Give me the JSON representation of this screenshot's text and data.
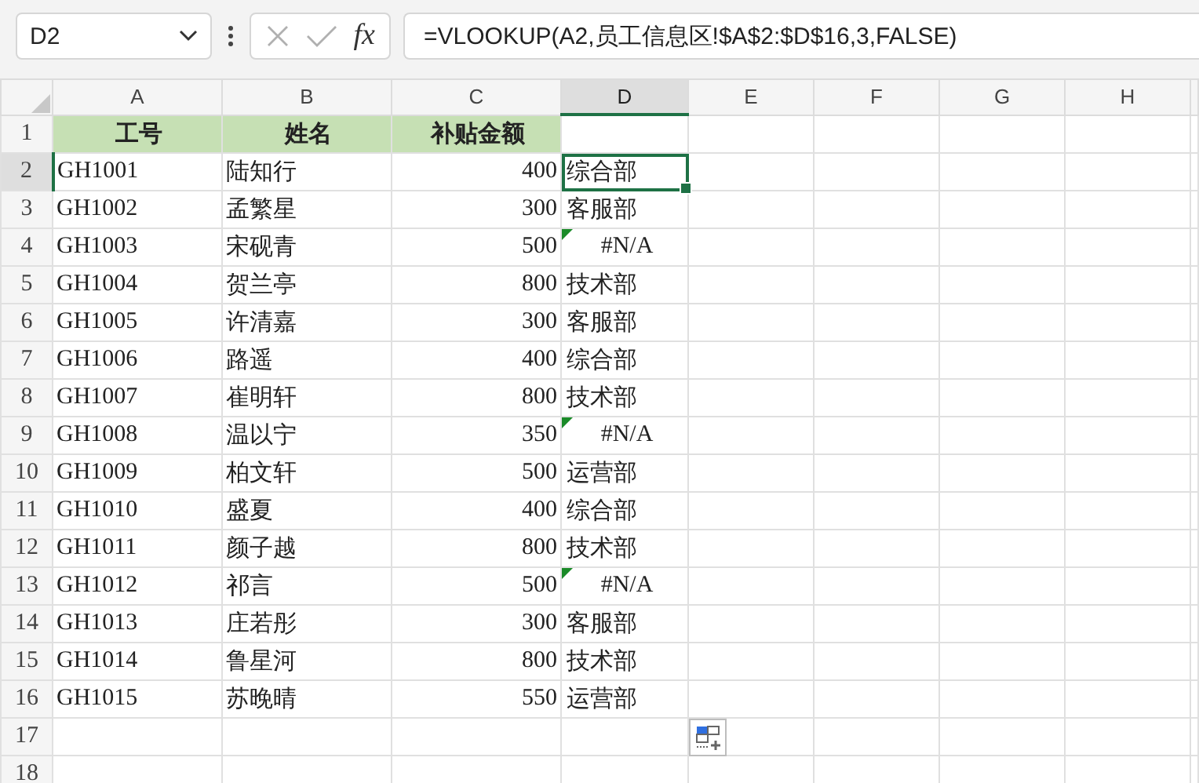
{
  "name_box": "D2",
  "formula_bar": {
    "function_label": "fx",
    "formula": "=VLOOKUP(A2,员工信息区!$A$2:$D$16,3,FALSE)"
  },
  "columns": [
    {
      "label": "A",
      "selected": false
    },
    {
      "label": "B",
      "selected": false
    },
    {
      "label": "C",
      "selected": false
    },
    {
      "label": "D",
      "selected": true
    },
    {
      "label": "E",
      "selected": false
    },
    {
      "label": "F",
      "selected": false
    },
    {
      "label": "G",
      "selected": false
    },
    {
      "label": "H",
      "selected": false
    }
  ],
  "rows": [
    {
      "kind": "header",
      "number": "1",
      "selected": false,
      "cells": [
        "工号",
        "姓名",
        "补贴金额"
      ]
    },
    {
      "kind": "data",
      "number": "2",
      "selected": true,
      "id": "GH1001",
      "name": "陆知行",
      "amount": "400",
      "dept": "综合部",
      "dept_error": false
    },
    {
      "kind": "data",
      "number": "3",
      "selected": false,
      "id": "GH1002",
      "name": "孟繁星",
      "amount": "300",
      "dept": "客服部",
      "dept_error": false
    },
    {
      "kind": "data",
      "number": "4",
      "selected": false,
      "id": "GH1003",
      "name": "宋砚青",
      "amount": "500",
      "dept": "#N/A",
      "dept_error": true
    },
    {
      "kind": "data",
      "number": "5",
      "selected": false,
      "id": "GH1004",
      "name": "贺兰亭",
      "amount": "800",
      "dept": "技术部",
      "dept_error": false
    },
    {
      "kind": "data",
      "number": "6",
      "selected": false,
      "id": "GH1005",
      "name": "许清嘉",
      "amount": "300",
      "dept": "客服部",
      "dept_error": false
    },
    {
      "kind": "data",
      "number": "7",
      "selected": false,
      "id": "GH1006",
      "name": "路遥",
      "amount": "400",
      "dept": "综合部",
      "dept_error": false
    },
    {
      "kind": "data",
      "number": "8",
      "selected": false,
      "id": "GH1007",
      "name": "崔明轩",
      "amount": "800",
      "dept": "技术部",
      "dept_error": false
    },
    {
      "kind": "data",
      "number": "9",
      "selected": false,
      "id": "GH1008",
      "name": "温以宁",
      "amount": "350",
      "dept": "#N/A",
      "dept_error": true
    },
    {
      "kind": "data",
      "number": "10",
      "selected": false,
      "id": "GH1009",
      "name": "柏文轩",
      "amount": "500",
      "dept": "运营部",
      "dept_error": false
    },
    {
      "kind": "data",
      "number": "11",
      "selected": false,
      "id": "GH1010",
      "name": "盛夏",
      "amount": "400",
      "dept": "综合部",
      "dept_error": false
    },
    {
      "kind": "data",
      "number": "12",
      "selected": false,
      "id": "GH1011",
      "name": "颜子越",
      "amount": "800",
      "dept": "技术部",
      "dept_error": false
    },
    {
      "kind": "data",
      "number": "13",
      "selected": false,
      "id": "GH1012",
      "name": "祁言",
      "amount": "500",
      "dept": "#N/A",
      "dept_error": true
    },
    {
      "kind": "data",
      "number": "14",
      "selected": false,
      "id": "GH1013",
      "name": "庄若彤",
      "amount": "300",
      "dept": "客服部",
      "dept_error": false
    },
    {
      "kind": "data",
      "number": "15",
      "selected": false,
      "id": "GH1014",
      "name": "鲁星河",
      "amount": "800",
      "dept": "技术部",
      "dept_error": false
    },
    {
      "kind": "data",
      "number": "16",
      "selected": false,
      "id": "GH1015",
      "name": "苏晚晴",
      "amount": "550",
      "dept": "运营部",
      "dept_error": false
    },
    {
      "kind": "empty",
      "number": "17",
      "selected": false
    },
    {
      "kind": "empty",
      "number": "18",
      "selected": false
    }
  ]
}
